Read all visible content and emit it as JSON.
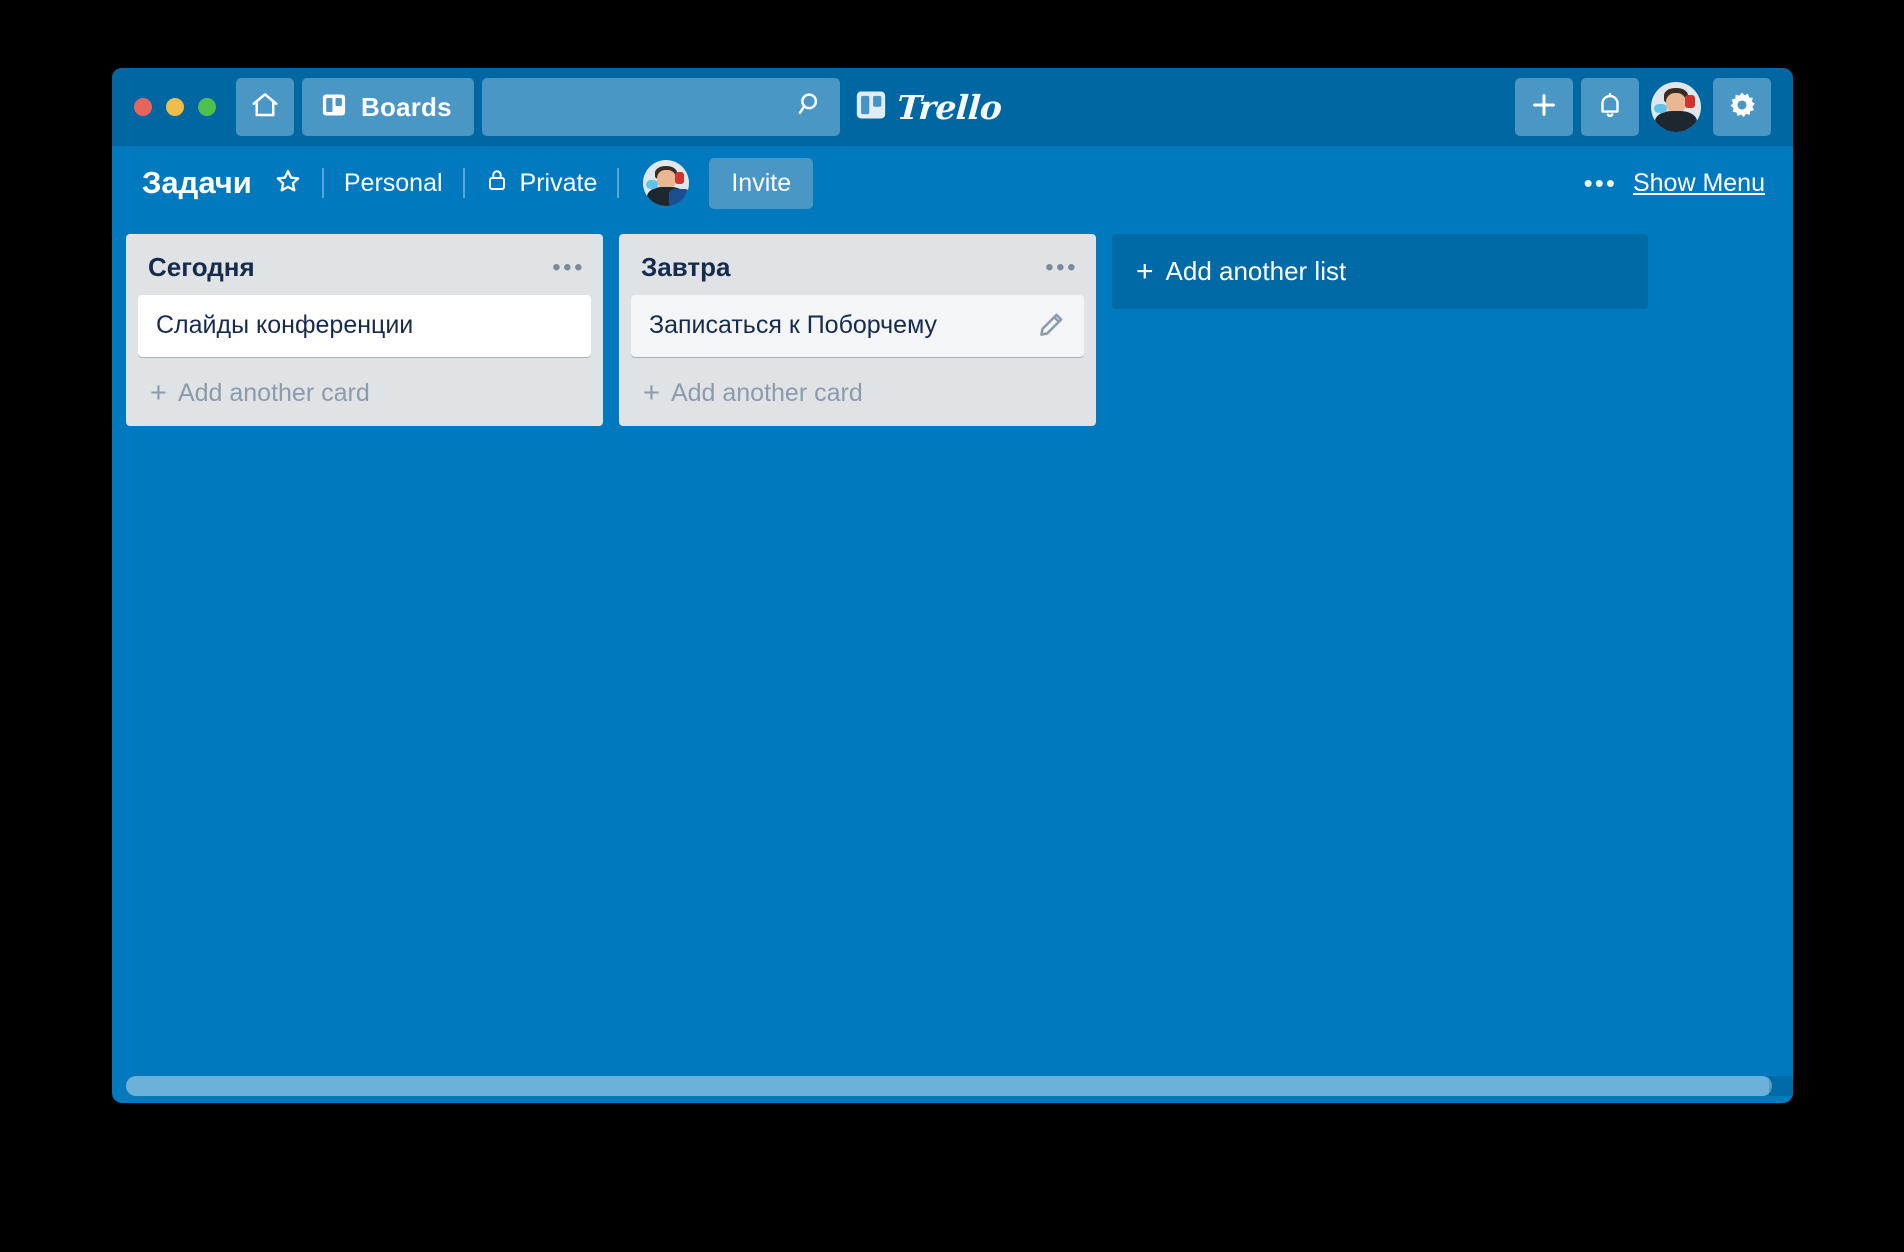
{
  "window": {
    "traffic_lights": [
      {
        "name": "close",
        "color": "#e8655c"
      },
      {
        "name": "minimize",
        "color": "#f0bd4b"
      },
      {
        "name": "zoom",
        "color": "#4ec04e"
      }
    ]
  },
  "titlebar": {
    "home_icon": "home-icon",
    "boards_icon": "board-icon",
    "boards_label": "Boards",
    "search_placeholder": "",
    "search_value": "",
    "search_icon": "search-icon",
    "logo_icon": "trello-board-icon",
    "logo_text": "Trello",
    "add_icon": "plus-icon",
    "notifications_icon": "bell-icon",
    "avatar_icon": "user-avatar",
    "settings_icon": "gear-icon"
  },
  "board_header": {
    "title": "Задачи",
    "star_icon": "star-icon",
    "team": "Personal",
    "visibility_icon": "lock-icon",
    "visibility": "Private",
    "member_avatar": "member-avatar",
    "invite_label": "Invite",
    "ellipsis": "•••",
    "show_menu_label": "Show Menu"
  },
  "board": {
    "lists": [
      {
        "title": "Сегодня",
        "menu_icon": "list-menu-icon",
        "cards": [
          {
            "title": "Слайды конференции",
            "has_edit_icon": false,
            "muted": false
          }
        ],
        "add_card_label": "Add another card"
      },
      {
        "title": "Завтра",
        "menu_icon": "list-menu-icon",
        "cards": [
          {
            "title": "Записаться к Поборчему",
            "has_edit_icon": true,
            "muted": true
          }
        ],
        "add_card_label": "Add another card"
      }
    ],
    "add_list_label": "Add another list"
  },
  "colors": {
    "board_background": "#0079bf",
    "titlebar_background": "#0067a3",
    "chrome_button": "#4a96c4",
    "list_background": "#dfe3e6",
    "card_background": "#ffffff",
    "card_muted_background": "#f4f5f7",
    "text_dark": "#172b4d",
    "text_muted": "#8c9bab"
  }
}
